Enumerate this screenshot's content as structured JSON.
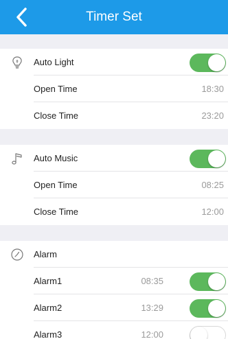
{
  "header": {
    "title": "Timer Set",
    "back_icon": "chevron-left-icon",
    "bg_color": "#1d9ae8"
  },
  "auto_light": {
    "icon": "lightbulb-icon",
    "label": "Auto Light",
    "enabled": true,
    "open_label": "Open Time",
    "open_value": "18:30",
    "close_label": "Close Time",
    "close_value": "23:20"
  },
  "auto_music": {
    "icon": "music-note-icon",
    "label": "Auto Music",
    "enabled": true,
    "open_label": "Open Time",
    "open_value": "08:25",
    "close_label": "Close Time",
    "close_value": "12:00"
  },
  "alarm": {
    "icon": "clock-icon",
    "label": "Alarm",
    "items": [
      {
        "label": "Alarm1",
        "time": "08:35",
        "enabled": true
      },
      {
        "label": "Alarm2",
        "time": "13:29",
        "enabled": true
      },
      {
        "label": "Alarm3",
        "time": "12:00",
        "enabled": false
      }
    ]
  },
  "colors": {
    "toggle_on": "#5cb85c",
    "background": "#efeff4"
  }
}
